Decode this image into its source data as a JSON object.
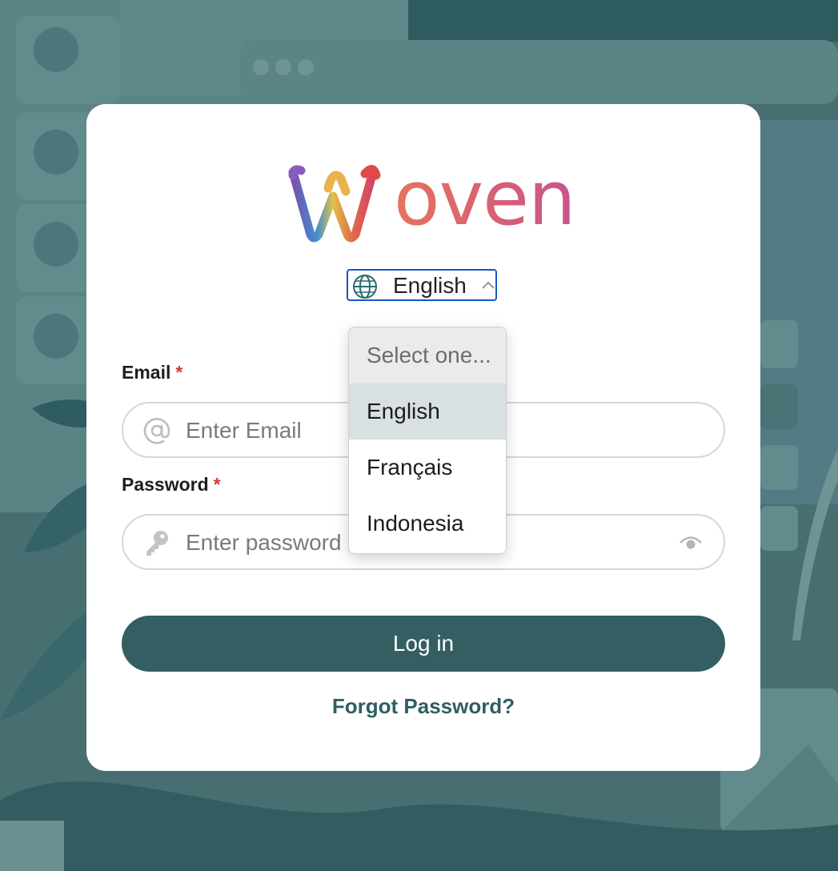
{
  "brand": {
    "name": "oven",
    "logo_letter": "W"
  },
  "language_selector": {
    "current": "English",
    "icon": "globe-icon",
    "state": "expanded",
    "options": [
      {
        "label": "Select one...",
        "placeholder": true
      },
      {
        "label": "English",
        "selected": true
      },
      {
        "label": "Français"
      },
      {
        "label": "Indonesia"
      }
    ]
  },
  "form": {
    "email": {
      "label": "Email",
      "required_mark": "*",
      "placeholder": "Enter Email",
      "value": "",
      "icon": "at-icon"
    },
    "password": {
      "label": "Password",
      "required_mark": "*",
      "placeholder": "Enter password",
      "value": "",
      "icon": "key-icon",
      "toggle_icon": "eye-icon"
    },
    "submit_label": "Log in",
    "forgot_label": "Forgot Password?"
  },
  "colors": {
    "primary": "#335f63",
    "background": "#476f72",
    "focus_border": "#1557c4",
    "required": "#d23c3c"
  }
}
